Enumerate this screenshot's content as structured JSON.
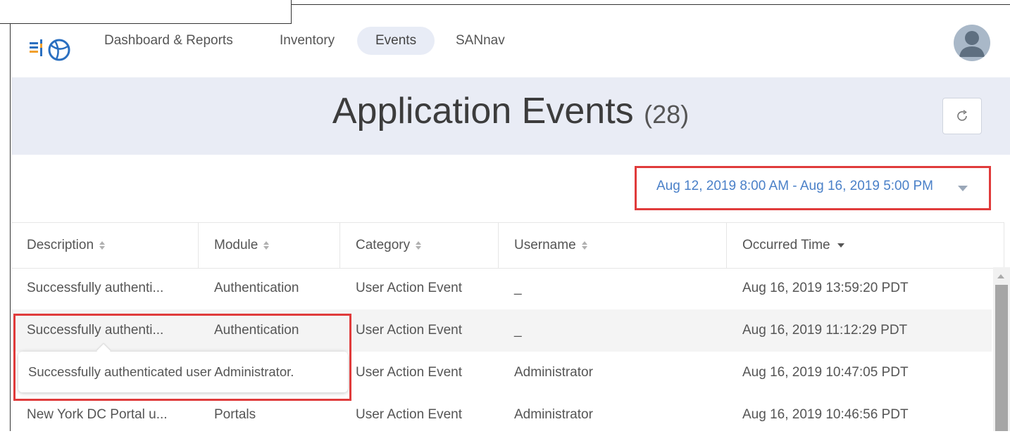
{
  "nav": {
    "tabs": [
      {
        "label": "Dashboard & Reports"
      },
      {
        "label": "Inventory"
      },
      {
        "label": "Events"
      },
      {
        "label": "SANnav"
      }
    ],
    "active_tab": "Events"
  },
  "header": {
    "title": "Application Events",
    "count": "(28)"
  },
  "date_range": "Aug 12, 2019 8:00 AM - Aug 16, 2019 5:00 PM",
  "table": {
    "columns": [
      "Description",
      "Module",
      "Category",
      "Username",
      "Occurred Time"
    ],
    "rows": [
      {
        "description": "Successfully authenti...",
        "module": "Authentication",
        "category": "User Action Event",
        "username": "_",
        "time": "Aug 16, 2019 13:59:20 PDT"
      },
      {
        "description": "Successfully authenti...",
        "module": "Authentication",
        "category": "User Action Event",
        "username": "_",
        "time": "Aug 16, 2019 11:12:29 PDT"
      },
      {
        "description": "",
        "module": "",
        "category": "User Action Event",
        "username": "Administrator",
        "time": "Aug 16, 2019 10:47:05 PDT"
      },
      {
        "description": "New York DC Portal u...",
        "module": "Portals",
        "category": "User Action Event",
        "username": "Administrator",
        "time": "Aug 16, 2019 10:46:56 PDT"
      }
    ]
  },
  "tooltip": "Successfully authenticated user Administrator.",
  "colors": {
    "header_band": "#e9ecf5",
    "accent_link": "#4a80c8",
    "highlight": "#e03b3b"
  }
}
